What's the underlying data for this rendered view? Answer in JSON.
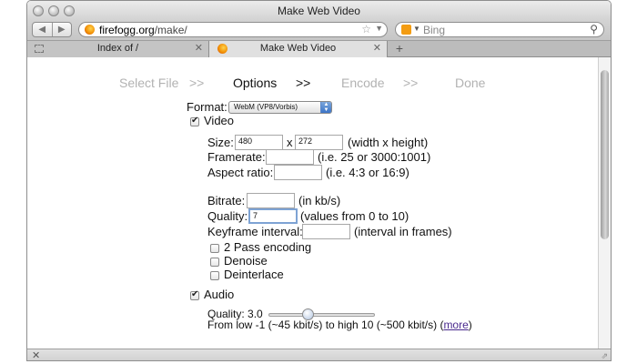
{
  "window": {
    "title": "Make Web Video"
  },
  "toolbar": {
    "back_icon": "back-arrow-icon",
    "forward_icon": "forward-arrow-icon",
    "url_domain": "firefogg.org",
    "url_path": "/make/",
    "search_placeholder": "Bing"
  },
  "tabs": [
    {
      "label": "Index of /",
      "active": false
    },
    {
      "label": "Make Web Video",
      "active": true
    }
  ],
  "steps": {
    "select_file": "Select File",
    "arrow": ">>",
    "options": "Options",
    "encode": "Encode",
    "done": "Done",
    "active": "Options"
  },
  "form": {
    "format_label": "Format:",
    "format_value": "WebM (VP8/Vorbis)",
    "video_label": "Video",
    "video_checked": true,
    "size_label": "Size:",
    "width": "480",
    "x": "x",
    "height": "272",
    "size_hint": "(width x height)",
    "framerate_label": "Framerate:",
    "framerate_value": "",
    "framerate_hint": "(i.e. 25 or 3000:1001)",
    "aspect_label": "Aspect ratio:",
    "aspect_value": "",
    "aspect_hint": "(i.e. 4:3 or 16:9)",
    "bitrate_label": "Bitrate:",
    "bitrate_value": "",
    "bitrate_hint": "(in kb/s)",
    "quality_label": "Quality:",
    "quality_value": "7",
    "quality_hint": "(values from 0 to 10)",
    "keyframe_label": "Keyframe interval:",
    "keyframe_value": "",
    "keyframe_hint": "(interval in frames)",
    "twopass_label": "2 Pass encoding",
    "twopass_checked": false,
    "denoise_label": "Denoise",
    "denoise_checked": false,
    "deinterlace_label": "Deinterlace",
    "deinterlace_checked": false,
    "audio_label": "Audio",
    "audio_checked": true,
    "audio_quality_label": "Quality: 3.0",
    "audio_quality_value": 3.0,
    "audio_quality_min": -1,
    "audio_quality_max": 10,
    "audio_range_text": "From low -1 (~45 kbit/s) to high 10 (~500 kbit/s) (",
    "more_link": "more",
    "close_paren": ")"
  }
}
